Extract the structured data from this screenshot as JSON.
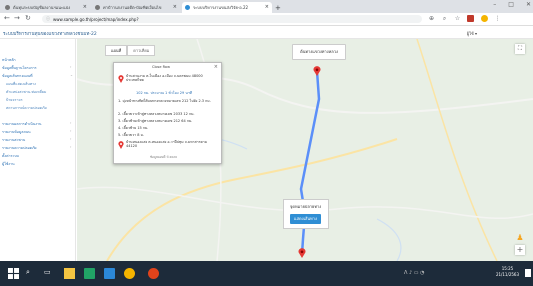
{
  "browser": {
    "tabs": [
      {
        "title": "ต้นทุนระบบบัญชีผลงานฯแนะแบ่ง",
        "active": false
      },
      {
        "title": "ค่าปำานกงานอดีต-บัณฑิตเงื่อนไข",
        "active": false
      },
      {
        "title": "ระบบบริหารงานขนส่งวิจัย-อ.22",
        "active": true
      }
    ],
    "url": "www.sample.go.th/project/map/index.php?",
    "window_controls": {
      "minimize": "–",
      "maximize": "□",
      "close": "✕"
    }
  },
  "app": {
    "name": "ระบบบริหารงานทุนของแขวงทางหลวงชนบท-22",
    "user": "ผู้ใช้ ▾"
  },
  "sidebar": {
    "items": [
      {
        "label": "หน้าหลัก",
        "sub": false
      },
      {
        "label": "ข้อมูลพื้นฐานโครงการ",
        "sub": false
      },
      {
        "label": "ข้อมูลเส้นทางแผนที่",
        "sub": false
      },
      {
        "label": "แผนที่แสดงเส้นทาง",
        "sub": true
      },
      {
        "label": "ตำแหน่งสะพาน-ท่อเหลี่ยม",
        "sub": true
      },
      {
        "label": "ป้ายจราจร",
        "sub": true
      },
      {
        "label": "สถานการณ์ความปลอดภัย",
        "sub": true
      },
      {
        "label": "รายงานผลการดำเนินงาน",
        "sub": false
      },
      {
        "label": "รายงานข้อมูลถนน",
        "sub": false
      },
      {
        "label": "รายงานสะพาน",
        "sub": false
      },
      {
        "label": "รายงานความปลอดภัย",
        "sub": false
      },
      {
        "label": "ตั้งค่าระบบ",
        "sub": false
      },
      {
        "label": "ผู้ใช้งาน",
        "sub": false
      }
    ]
  },
  "map": {
    "tabs": [
      "แผนที่",
      "ดาวเทียม"
    ],
    "popup": {
      "header": "Close Row",
      "origin": "บ้านสวนงาม ต.ในเมือง อ.เมือง จ.นครพนม 48000 ประเทศไทย",
      "summary": "102 กม. ประมาณ 1 ชั่วโมง 29 นาที",
      "steps": [
        "1. มุ่งหน้าทางทิศใต้บนทางหลวงหมายเลข 212 ไปยัง 2.3 กม.",
        "2. เลี้ยวขวาเข้าสู่ทางหลวงหมายเลข 2033 12 กม.",
        "3. เลี้ยวซ้ายเข้าสู่ทางหลวงหมายเลข 212 64 กม.",
        "4. เลี้ยวซ้าย 15 กม.",
        "5. เลี้ยวขวา 8 ม."
      ],
      "destination": "บ้านหนองแสง ต.หนองแสง อ.วาปีปทุม จ.มหาสารคาม 44120",
      "footer": "ข้อมูลแผนที่ ©2020"
    },
    "top_label": "ต้นทางแขวงทางหลวง",
    "bottom_card": {
      "label": "จุดหมายปลายทาง",
      "button": "แสดงเส้นทาง"
    },
    "controls": {
      "fullscreen": "⛶",
      "zoom_in": "+",
      "zoom_out": "−"
    }
  },
  "taskbar": {
    "time": "15:25",
    "date": "21/11/2563"
  },
  "colors": {
    "accent": "#2f8ed4",
    "route": "#5b8ff9",
    "marker": "#e53935",
    "taskbar": "#1d2b3a"
  }
}
